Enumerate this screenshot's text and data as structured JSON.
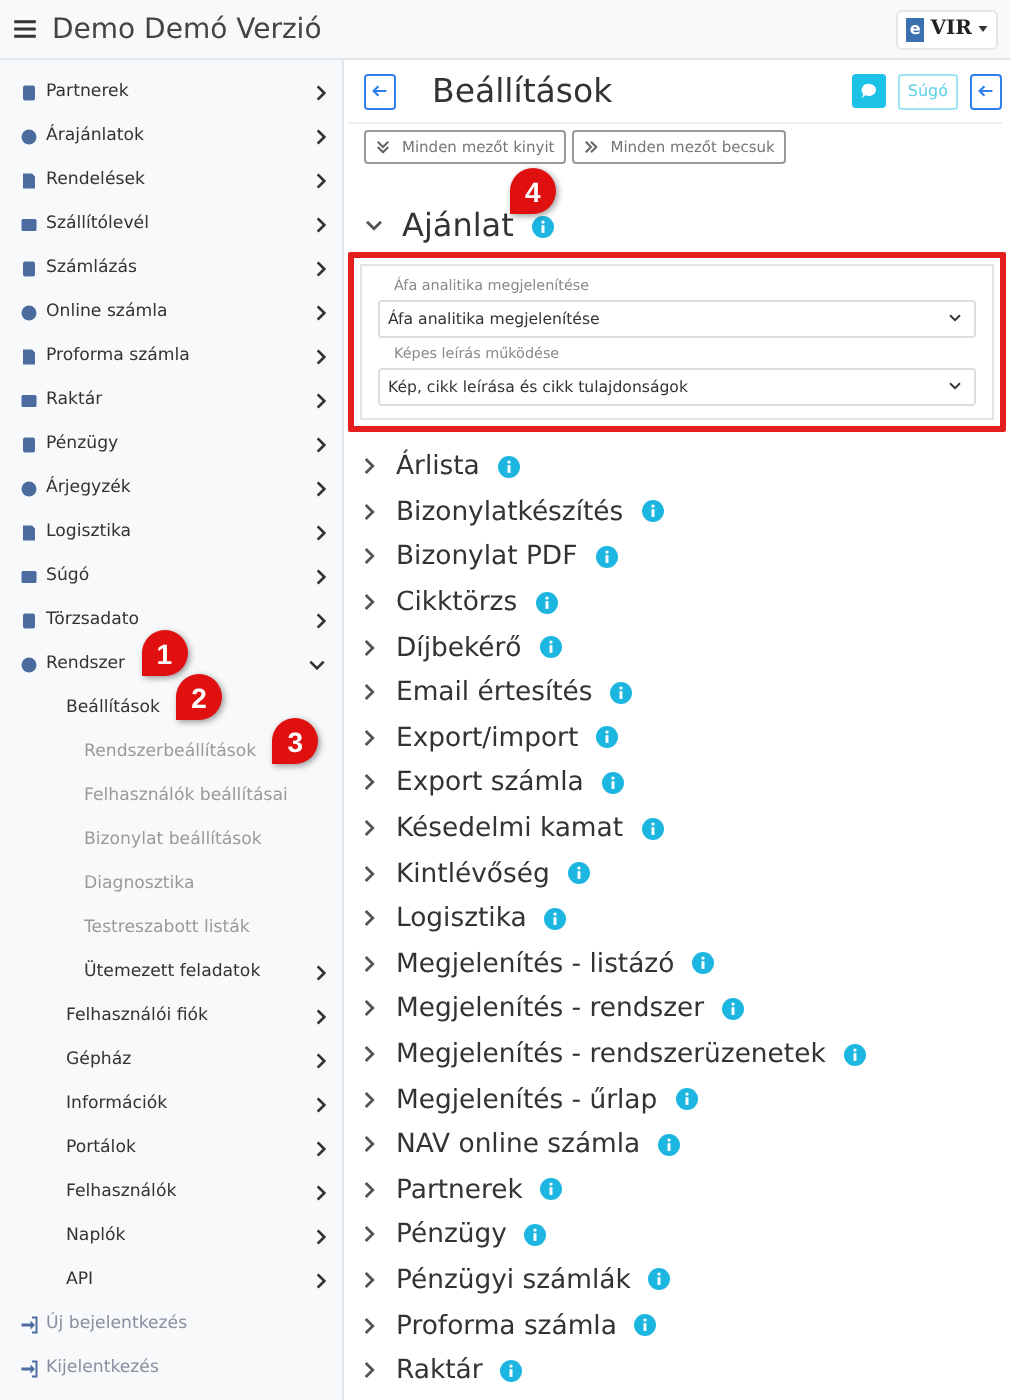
{
  "header": {
    "title": "Demo Demó Verzió",
    "logo": {
      "mark": "e",
      "text": "VIR"
    }
  },
  "sidebar": {
    "items": [
      {
        "label": "Partnerek",
        "expandable": true,
        "expanded": false
      },
      {
        "label": "Árajánlatok",
        "expandable": true,
        "expanded": false
      },
      {
        "label": "Rendelések",
        "expandable": true,
        "expanded": false
      },
      {
        "label": "Szállítólevél",
        "expandable": true,
        "expanded": false
      },
      {
        "label": "Számlázás",
        "expandable": true,
        "expanded": false
      },
      {
        "label": "Online számla",
        "expandable": true,
        "expanded": false
      },
      {
        "label": "Proforma számla",
        "expandable": true,
        "expanded": false
      },
      {
        "label": "Raktár",
        "expandable": true,
        "expanded": false
      },
      {
        "label": "Pénzügy",
        "expandable": true,
        "expanded": false
      },
      {
        "label": "Árjegyzék",
        "expandable": true,
        "expanded": false
      },
      {
        "label": "Logisztika",
        "expandable": true,
        "expanded": false
      },
      {
        "label": "Súgó",
        "expandable": true,
        "expanded": false
      },
      {
        "label": "Törzsadato",
        "expandable": true,
        "expanded": false
      },
      {
        "label": "Rendszer",
        "expandable": true,
        "expanded": true,
        "callout": "1",
        "children": [
          {
            "label": "Beállítások",
            "expandable": false,
            "callout": "2",
            "children": [
              {
                "label": "Rendszerbeállítások",
                "expandable": false,
                "callout": "3"
              },
              {
                "label": "Felhasználók beállításai",
                "expandable": false
              },
              {
                "label": "Bizonylat beállítások",
                "expandable": false
              },
              {
                "label": "Diagnosztika",
                "expandable": false
              },
              {
                "label": "Testreszabott listák",
                "expandable": false
              },
              {
                "label": "Ütemezett feladatok",
                "expandable": true,
                "expanded": false
              }
            ]
          },
          {
            "label": "Felhasználói fiók",
            "expandable": true,
            "expanded": false
          },
          {
            "label": "Gépház",
            "expandable": true,
            "expanded": false
          },
          {
            "label": "Információk",
            "expandable": true,
            "expanded": false
          },
          {
            "label": "Portálok",
            "expandable": true,
            "expanded": false
          },
          {
            "label": "Felhasználók",
            "expandable": true,
            "expanded": false
          },
          {
            "label": "Naplók",
            "expandable": true,
            "expanded": false
          },
          {
            "label": "API",
            "expandable": true,
            "expanded": false
          }
        ]
      },
      {
        "label": "Új bejelentkezés",
        "expandable": false
      },
      {
        "label": "Kijelentkezés",
        "expandable": false
      }
    ]
  },
  "page": {
    "title": "Beállítások",
    "help_button": "Súgó",
    "toolbar": [
      "Minden mezőt kinyit",
      "Minden mezőt becsuk"
    ]
  },
  "sections": [
    {
      "title": "Ajánlat",
      "expanded": true,
      "callout": "4",
      "highlighted": true,
      "fields": [
        {
          "label": "Áfa analitika megjelenítése",
          "value": "Áfa analitika megjelenítése"
        },
        {
          "label": "Képes leírás működése",
          "value": "Kép, cikk leírása és cikk tulajdonságok"
        }
      ]
    },
    {
      "title": "Árlista",
      "expanded": false
    },
    {
      "title": "Bizonylatkészítés",
      "expanded": false
    },
    {
      "title": "Bizonylat PDF",
      "expanded": false
    },
    {
      "title": "Cikktörzs",
      "expanded": false
    },
    {
      "title": "Díjbekérő",
      "expanded": false
    },
    {
      "title": "Email értesítés",
      "expanded": false
    },
    {
      "title": "Export/import",
      "expanded": false
    },
    {
      "title": "Export számla",
      "expanded": false
    },
    {
      "title": "Késedelmi kamat",
      "expanded": false
    },
    {
      "title": "Kintlévőség",
      "expanded": false
    },
    {
      "title": "Logisztika",
      "expanded": false
    },
    {
      "title": "Megjelenítés - listázó",
      "expanded": false
    },
    {
      "title": "Megjelenítés - rendszer",
      "expanded": false
    },
    {
      "title": "Megjelenítés - rendszerüzenetek",
      "expanded": false
    },
    {
      "title": "Megjelenítés - űrlap",
      "expanded": false
    },
    {
      "title": "NAV online számla",
      "expanded": false
    },
    {
      "title": "Partnerek",
      "expanded": false
    },
    {
      "title": "Pénzügy",
      "expanded": false
    },
    {
      "title": "Pénzügyi számlák",
      "expanded": false
    },
    {
      "title": "Proforma számla",
      "expanded": false
    },
    {
      "title": "Raktár",
      "expanded": false
    }
  ]
}
